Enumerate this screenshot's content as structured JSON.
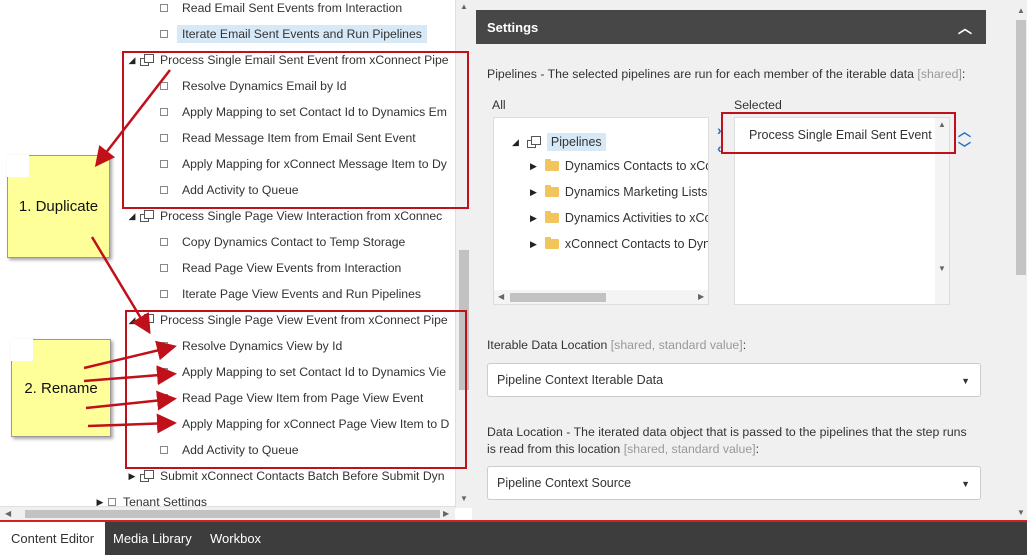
{
  "tree": {
    "rows": [
      {
        "label": "Read Email Sent Events from Interaction"
      },
      {
        "label": "Iterate Email Sent Events and Run Pipelines"
      },
      {
        "label": "Process Single Email Sent Event from xConnect Pipe"
      },
      {
        "label": "Resolve Dynamics Email by Id"
      },
      {
        "label": "Apply Mapping to set Contact Id to Dynamics Em"
      },
      {
        "label": "Read Message Item from Email Sent Event"
      },
      {
        "label": "Apply Mapping for xConnect Message Item to Dy"
      },
      {
        "label": "Add Activity to Queue"
      },
      {
        "label": "Process Single Page View Interaction from xConnec"
      },
      {
        "label": "Copy Dynamics Contact to Temp Storage"
      },
      {
        "label": "Read Page View Events from Interaction"
      },
      {
        "label": "Iterate Page View Events and Run Pipelines"
      },
      {
        "label": "Process Single Page View Event from xConnect Pipe"
      },
      {
        "label": "Resolve Dynamics View by Id"
      },
      {
        "label": "Apply Mapping to set Contact Id to Dynamics Vie"
      },
      {
        "label": "Read Page View Item from Page View Event"
      },
      {
        "label": "Apply Mapping for xConnect Page View Item to D"
      },
      {
        "label": "Add Activity to Queue"
      },
      {
        "label": "Submit xConnect Contacts Batch Before Submit Dyn"
      },
      {
        "label": "Tenant Settings"
      }
    ]
  },
  "settings": {
    "header": "Settings",
    "pipelines": {
      "label": "Pipelines - The selected pipelines are run for each member of the iterable data",
      "meta": "[shared]",
      "all_label": "All",
      "selected_label": "Selected",
      "root": "Pipelines",
      "items": [
        "Dynamics Contacts to xCo",
        "Dynamics Marketing Lists",
        "Dynamics Activities to xCo",
        "xConnect Contacts to Dyn"
      ],
      "selected_items": [
        "Process Single Email Sent Event f"
      ]
    },
    "iterable": {
      "label": "Iterable Data Location",
      "meta": "[shared, standard value]",
      "value": "Pipeline Context Iterable Data"
    },
    "data_location": {
      "label_line1": "Data Location - The iterated data object that is passed to the pipelines that the step runs",
      "label_line2": "is read from this location",
      "meta": "[shared, standard value]",
      "value": "Pipeline Context Source"
    }
  },
  "annotations": {
    "note1": "1. Duplicate",
    "note2": "2. Rename"
  },
  "tabs": [
    "Content Editor",
    "Media Library",
    "Workbox"
  ]
}
